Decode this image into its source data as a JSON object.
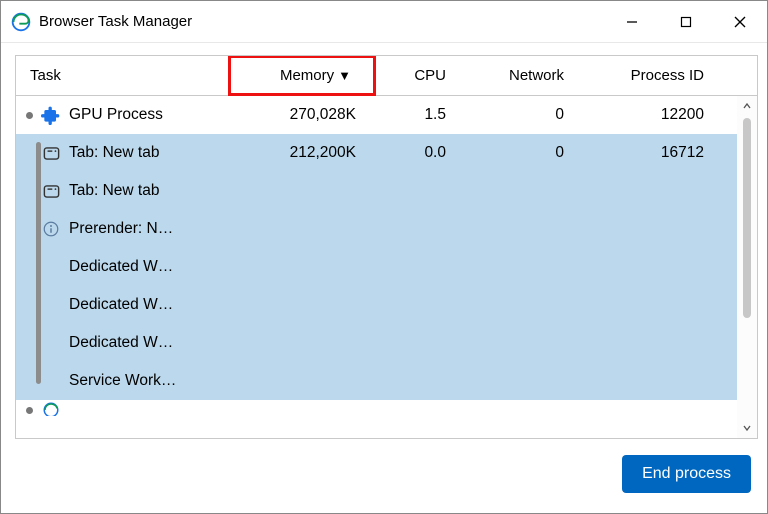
{
  "window": {
    "title": "Browser Task Manager"
  },
  "columns": {
    "task": "Task",
    "memory": "Memory",
    "cpu": "CPU",
    "network": "Network",
    "pid": "Process ID",
    "sort_indicator": "▼"
  },
  "rows": [
    {
      "selected": false,
      "bullet": true,
      "icon": "puzzle",
      "name": "GPU Process",
      "memory": "270,028K",
      "cpu": "1.5",
      "network": "0",
      "pid": "12200"
    },
    {
      "selected": true,
      "bullet": false,
      "icon": "tab",
      "name": "Tab: New tab",
      "memory": "212,200K",
      "cpu": "0.0",
      "network": "0",
      "pid": "16712"
    },
    {
      "selected": true,
      "bullet": false,
      "icon": "tab",
      "name": "Tab: New tab",
      "memory": "",
      "cpu": "",
      "network": "",
      "pid": ""
    },
    {
      "selected": true,
      "bullet": false,
      "icon": "info",
      "name": "Prerender: N…",
      "memory": "",
      "cpu": "",
      "network": "",
      "pid": ""
    },
    {
      "selected": true,
      "bullet": false,
      "icon": "",
      "name": "Dedicated W…",
      "memory": "",
      "cpu": "",
      "network": "",
      "pid": ""
    },
    {
      "selected": true,
      "bullet": false,
      "icon": "",
      "name": "Dedicated W…",
      "memory": "",
      "cpu": "",
      "network": "",
      "pid": ""
    },
    {
      "selected": true,
      "bullet": false,
      "icon": "",
      "name": "Dedicated W…",
      "memory": "",
      "cpu": "",
      "network": "",
      "pid": ""
    },
    {
      "selected": true,
      "bullet": false,
      "icon": "",
      "name": "Service Work…",
      "memory": "",
      "cpu": "",
      "network": "",
      "pid": ""
    }
  ],
  "partial_row": {
    "icon": "edge",
    "memory": "",
    "cpu": "",
    "network": "",
    "pid": ""
  },
  "footer": {
    "end_process": "End process"
  }
}
